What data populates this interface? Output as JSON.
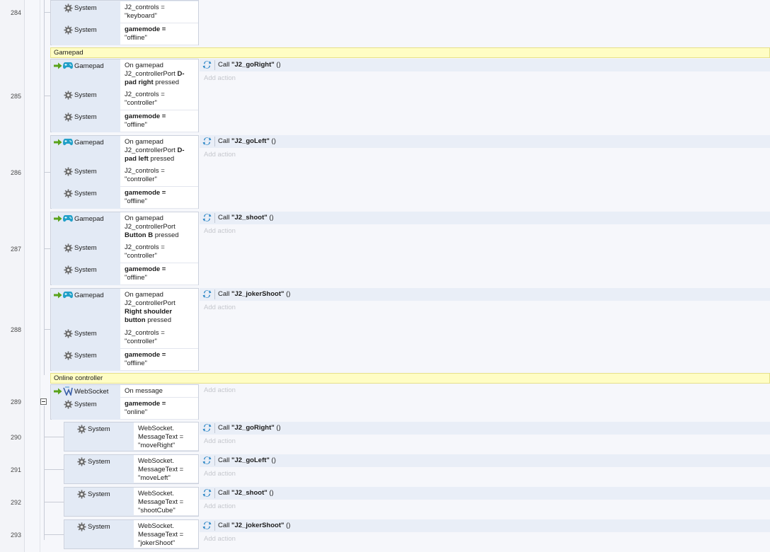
{
  "colors": {
    "group_bg": "#fffdc4",
    "condition_bg": "#e3eaf5",
    "action_bg": "#e9eef7",
    "gamepad_icon": "#22a0c8",
    "arrow_icon": "#5aa31c",
    "call_icon": "#1b7ec2"
  },
  "line_numbers": [
    "284",
    "285",
    "286",
    "287",
    "288",
    "289",
    "290",
    "291",
    "292",
    "293"
  ],
  "ui": {
    "add_action": "Add action",
    "call_word": "Call",
    "call_args": "()",
    "eq": "="
  },
  "group_gamepad": "Gamepad",
  "group_online": "Online controller",
  "ev284": {
    "c1": {
      "obj": "System",
      "a": "J2_controls =",
      "b": "\"keyboard\""
    },
    "c2": {
      "obj": "System",
      "bold": "gamemode =",
      "b": "\"offline\""
    }
  },
  "ev285": {
    "c1": {
      "obj": "Gamepad",
      "l1": "On gamepad",
      "l2": "J2_controllerPort",
      "l2b": "D-",
      "l3b": "pad right",
      "l3": "pressed"
    },
    "c2": {
      "obj": "System",
      "a": "J2_controls =",
      "b": "\"controller\""
    },
    "c3": {
      "obj": "System",
      "bold": "gamemode =",
      "b": "\"offline\""
    },
    "call": "\"J2_goRight\""
  },
  "ev286": {
    "c1": {
      "obj": "Gamepad",
      "l1": "On gamepad",
      "l2": "J2_controllerPort",
      "l2b": "D-",
      "l3b": "pad left",
      "l3": "pressed"
    },
    "c2": {
      "obj": "System",
      "a": "J2_controls =",
      "b": "\"controller\""
    },
    "c3": {
      "obj": "System",
      "bold": "gamemode =",
      "b": "\"offline\""
    },
    "call": "\"J2_goLeft\""
  },
  "ev287": {
    "c1": {
      "obj": "Gamepad",
      "l1": "On gamepad",
      "l2": "J2_controllerPort",
      "l3b": "Button B",
      "l3": "pressed"
    },
    "c2": {
      "obj": "System",
      "a": "J2_controls =",
      "b": "\"controller\""
    },
    "c3": {
      "obj": "System",
      "bold": "gamemode =",
      "b": "\"offline\""
    },
    "call": "\"J2_shoot\""
  },
  "ev288": {
    "c1": {
      "obj": "Gamepad",
      "l1": "On gamepad",
      "l2": "J2_controllerPort",
      "l3b": "Right shoulder",
      "l4b": "button",
      "l4": "pressed"
    },
    "c2": {
      "obj": "System",
      "a": "J2_controls =",
      "b": "\"controller\""
    },
    "c3": {
      "obj": "System",
      "bold": "gamemode =",
      "b": "\"offline\""
    },
    "call": "\"J2_jokerShoot\""
  },
  "ev289": {
    "c1": {
      "obj": "WebSocket",
      "l1": "On message"
    },
    "c2": {
      "obj": "System",
      "bold": "gamemode =",
      "b": "\"online\""
    }
  },
  "ev290": {
    "obj": "System",
    "l1": "WebSocket.",
    "l2": "MessageText =",
    "l3": "\"moveRight\"",
    "call": "\"J2_goRight\""
  },
  "ev291": {
    "obj": "System",
    "l1": "WebSocket.",
    "l2": "MessageText =",
    "l3": "\"moveLeft\"",
    "call": "\"J2_goLeft\""
  },
  "ev292": {
    "obj": "System",
    "l1": "WebSocket.",
    "l2": "MessageText =",
    "l3": "\"shootCube\"",
    "call": "\"J2_shoot\""
  },
  "ev293": {
    "obj": "System",
    "l1": "WebSocket.",
    "l2": "MessageText =",
    "l3": "\"jokerShoot\"",
    "call": "\"J2_jokerShoot\""
  }
}
